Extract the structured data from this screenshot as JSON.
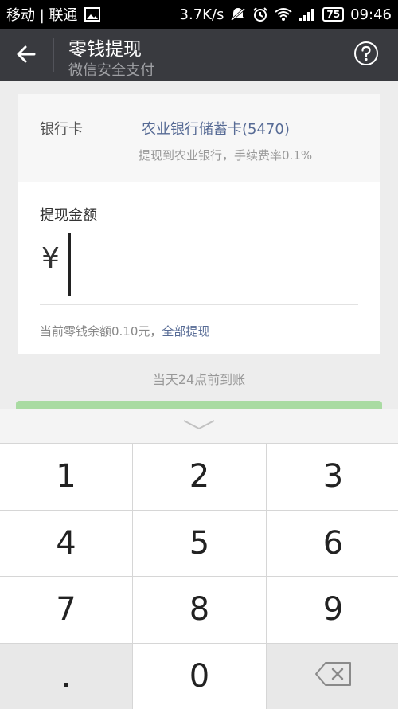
{
  "status_bar": {
    "carrier": "移动 | 联通",
    "speed": "3.7K/s",
    "battery": "75",
    "time": "09:46"
  },
  "header": {
    "title": "零钱提现",
    "subtitle": "微信安全支付",
    "back_icon": "arrow-left-icon",
    "help_icon": "question-circle-icon"
  },
  "bank": {
    "label": "银行卡",
    "name": "农业银行储蓄卡(5470)",
    "fee_note": "提现到农业银行，手续费率0.1%"
  },
  "amount": {
    "label": "提现金额",
    "currency": "¥",
    "value": "",
    "balance_text": "当前零钱余额0.10元，",
    "withdraw_all": "全部提现"
  },
  "arrival_note": "当天24点前到账",
  "keypad": {
    "keys": [
      "1",
      "2",
      "3",
      "4",
      "5",
      "6",
      "7",
      "8",
      "9",
      ".",
      "0"
    ],
    "delete_icon": "backspace-icon",
    "collapse_icon": "chevron-down-icon"
  },
  "colors": {
    "titlebar": "#393a3f",
    "link": "#576b95",
    "button_green": "#a9dba2"
  }
}
